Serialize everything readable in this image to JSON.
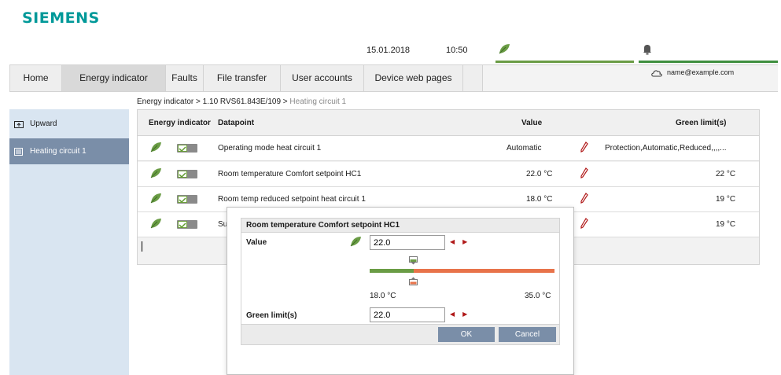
{
  "brand": {
    "logo": "SIEMENS",
    "color": "#009999"
  },
  "topbar": {
    "date": "15.01.2018",
    "time": "10:50",
    "icons": [
      "leaf-icon",
      "bell-icon"
    ],
    "accent_green": "#6a9c45"
  },
  "nav": {
    "tabs": [
      {
        "label": "Home",
        "active": false
      },
      {
        "label": "Energy indicator",
        "active": true
      },
      {
        "label": "Faults",
        "active": false
      },
      {
        "label": "File transfer",
        "active": false
      },
      {
        "label": "User accounts",
        "active": false
      },
      {
        "label": "Device web pages",
        "active": false
      }
    ],
    "user_email": "name@example.com"
  },
  "breadcrumb": {
    "part1": "Energy indicator",
    "sep": " > ",
    "part2": "1.10 RVS61.843E/109",
    "current": "Heating circuit 1"
  },
  "sidebar": {
    "items": [
      {
        "label": "Upward",
        "icon": "folder-up-icon",
        "selected": false
      },
      {
        "label": "Heating circuit 1",
        "icon": "list-icon",
        "selected": true
      }
    ]
  },
  "table": {
    "headers": {
      "energy_indicator": "Energy indicator",
      "datapoint": "Datapoint",
      "value": "Value",
      "green_limit": "Green limit(s)"
    },
    "rows": [
      {
        "datapoint": "Operating mode heat circuit 1",
        "value": "Automatic",
        "green_limit": "Protection,Automatic,Reduced,,,,..."
      },
      {
        "datapoint": "Room temperature Comfort setpoint HC1",
        "value": "22.0 °C",
        "green_limit": "22 °C"
      },
      {
        "datapoint": "Room temp reduced setpoint heat circuit 1",
        "value": "18.0 °C",
        "green_limit": "19 °C"
      },
      {
        "datapoint": "Su",
        "value": "",
        "green_limit": "19 °C"
      }
    ]
  },
  "dialog": {
    "title": "Room temperature Comfort setpoint HC1",
    "value_label": "Value",
    "value": "22.0",
    "range_min": "18.0 °C",
    "range_max": "35.0 °C",
    "slider_fraction": 0.235,
    "green_limit_label": "Green limit(s)",
    "green_limit_value": "22.0",
    "ok_label": "OK",
    "cancel_label": "Cancel",
    "colors": {
      "green": "#6a9c45",
      "orange": "#e8734a",
      "button": "#7a8ea8"
    }
  }
}
